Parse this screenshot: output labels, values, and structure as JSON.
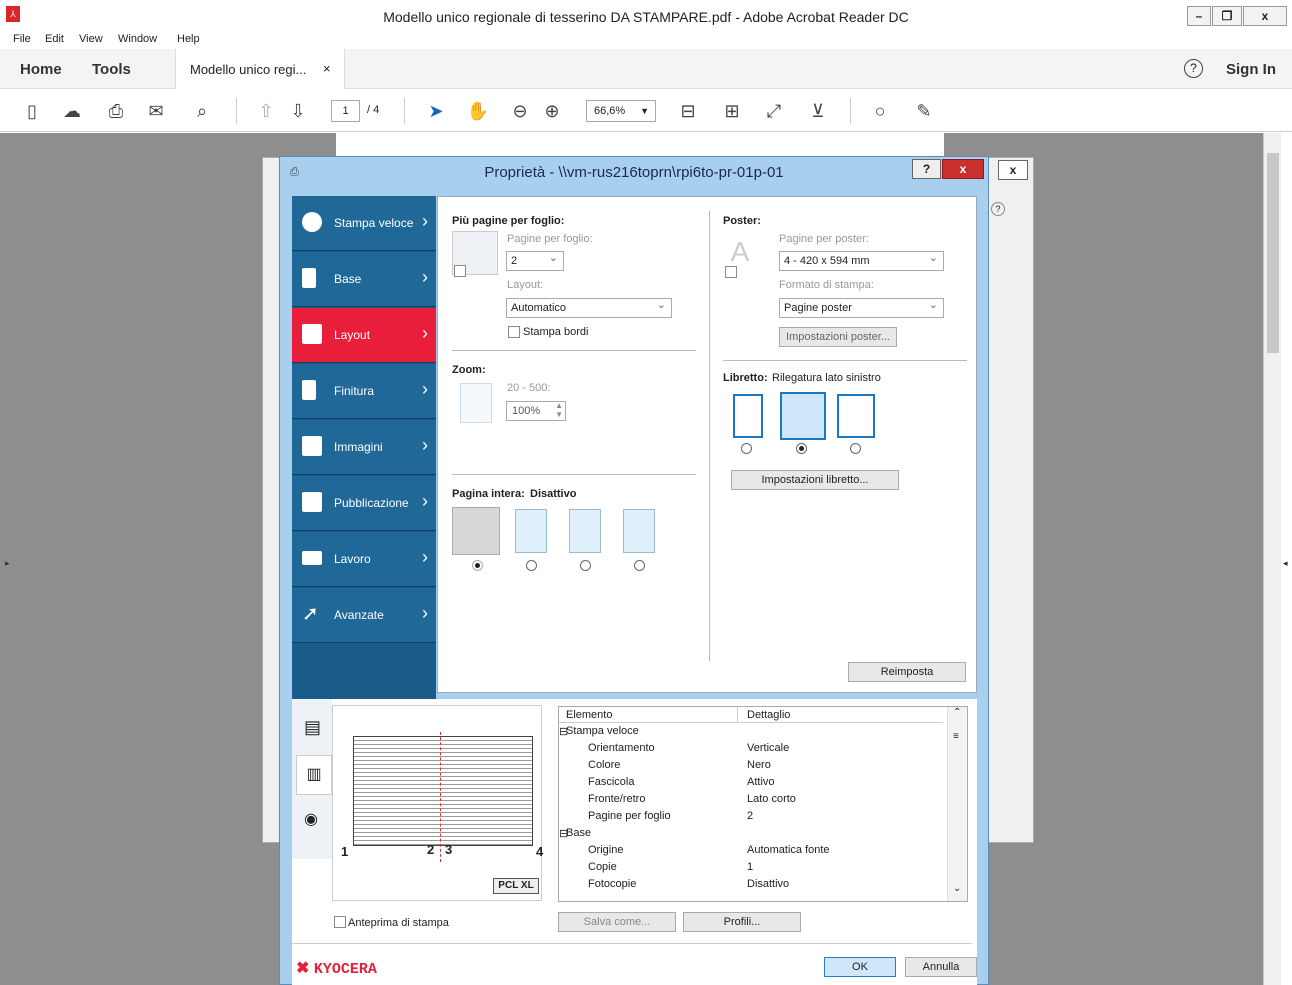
{
  "window": {
    "title": "Modello unico regionale di tesserino DA STAMPARE.pdf - Adobe Acrobat Reader DC",
    "minimize": "–",
    "restore": "❐",
    "close": "x"
  },
  "menu": [
    "File",
    "Edit",
    "View",
    "Window",
    "Help"
  ],
  "tabs": {
    "home": "Home",
    "tools": "Tools",
    "doc": "Modello unico regi...",
    "doc_close": "×",
    "help": "?",
    "signin": "Sign In"
  },
  "toolbar": {
    "page_current": "1",
    "page_total": "/ 4",
    "zoom": "66,6%"
  },
  "dialog": {
    "title": "Proprietà - \\\\vm-rus216toprn\\rpi6to-pr-01p-01",
    "help": "?",
    "close": "x",
    "nav": [
      "Stampa veloce",
      "Base",
      "Layout",
      "Finitura",
      "Immagini",
      "Pubblicazione",
      "Lavoro",
      "Avanzate"
    ],
    "more_pages": {
      "heading": "Più pagine per foglio:",
      "pages_label": "Pagine per foglio:",
      "pages_value": "2",
      "layout_label": "Layout:",
      "layout_value": "Automatico",
      "borders": "Stampa bordi"
    },
    "zoom": {
      "heading": "Zoom:",
      "range": "20 - 500:",
      "value": "100%"
    },
    "full_page": {
      "heading": "Pagina intera:",
      "state": "Disattivo"
    },
    "poster": {
      "heading": "Poster:",
      "pages_label": "Pagine per poster:",
      "pages_value": "4 - 420 x 594 mm",
      "format_label": "Formato di stampa:",
      "format_value": "Pagine poster",
      "settings": "Impostazioni poster..."
    },
    "booklet": {
      "heading": "Libretto:",
      "value": "Rilegatura lato sinistro",
      "settings": "Impostazioni libretto..."
    },
    "reset": "Reimposta",
    "preview_badge": "PCL XL",
    "preview_nums": [
      "1",
      "2",
      "3",
      "4"
    ],
    "details_headers": [
      "Elemento",
      "Dettaglio"
    ],
    "details": [
      {
        "k": "Stampa veloce",
        "v": "",
        "group": true
      },
      {
        "k": "Orientamento",
        "v": "Verticale"
      },
      {
        "k": "Colore",
        "v": "Nero"
      },
      {
        "k": "Fascicola",
        "v": "Attivo"
      },
      {
        "k": "Fronte/retro",
        "v": "Lato corto"
      },
      {
        "k": "Pagine per foglio",
        "v": "2"
      },
      {
        "k": "Base",
        "v": "",
        "group": true
      },
      {
        "k": "Origine",
        "v": "Automatica fonte"
      },
      {
        "k": "Copie",
        "v": "1"
      },
      {
        "k": "Fotocopie",
        "v": "Disattivo"
      }
    ],
    "print_preview": "Anteprima di stampa",
    "save_as": "Salva come...",
    "profiles": "Profili...",
    "brand": "KYOCERA",
    "ok": "OK",
    "cancel": "Annulla"
  },
  "colors": {
    "accent": "#e81e3a",
    "nav": "#1f6897",
    "dialog": "#a8cfee"
  }
}
